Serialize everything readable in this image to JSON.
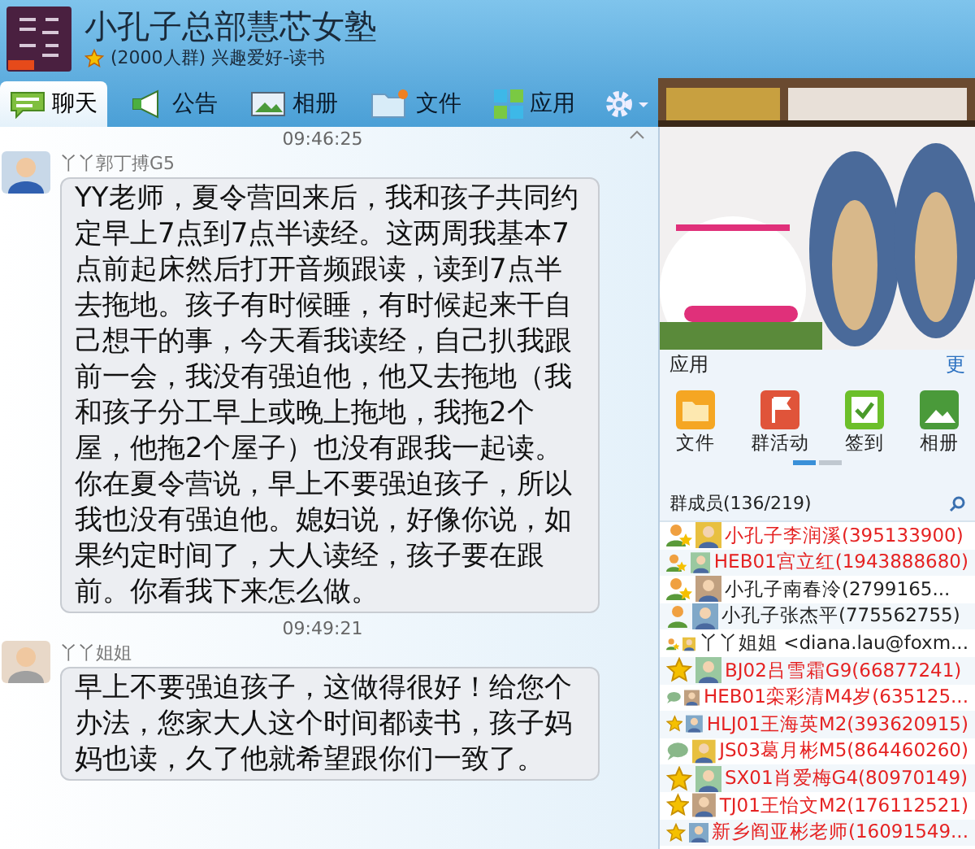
{
  "group": {
    "name": "小孔子总部慧芯女塾",
    "subtitle": "(2000人群) 兴趣爱好-读书"
  },
  "tabs": [
    {
      "label": "聊天",
      "kind": "chat",
      "selected": true
    },
    {
      "label": "公告",
      "kind": "notice",
      "selected": false
    },
    {
      "label": "相册",
      "kind": "album",
      "selected": false
    },
    {
      "label": "文件",
      "kind": "file",
      "selected": false
    },
    {
      "label": "应用",
      "kind": "apps",
      "selected": false
    }
  ],
  "messages": [
    {
      "time": "09:46:25",
      "sender": "丫丫郭丁搏G5",
      "paragraphs": [
        "YY老师，夏令营回来后，我和孩子共同约定早上7点到7点半读经。这两周我基本7点前起床然后打开音频跟读，读到7点半去拖地。孩子有时候睡，有时候起来干自己想干的事，今天看我读经，自己扒我跟前一会，我没有强迫他，他又去拖地（我和孩子分工早上或晚上拖地，我拖2个屋，他拖2个屋子）也没有跟我一起读。",
        "你在夏令营说，早上不要强迫孩子，所以我也没有强迫他。媳妇说，好像你说，如果约定时间了，大人读经，孩子要在跟前。你看我下来怎么做。"
      ]
    },
    {
      "time": "09:49:21",
      "sender": "丫丫姐姐",
      "paragraphs": [
        "早上不要强迫孩子，这做得很好！给您个办法，您家大人这个时间都读书，孩子妈妈也读，久了他就希望跟你们一致了。"
      ]
    }
  ],
  "apps": {
    "title": "应用",
    "more": "更",
    "items": [
      {
        "label": "文件",
        "kind": "file"
      },
      {
        "label": "群活动",
        "kind": "event"
      },
      {
        "label": "签到",
        "kind": "checkin"
      },
      {
        "label": "相册",
        "kind": "album"
      }
    ]
  },
  "members": {
    "title": "群成员(136/219)",
    "items": [
      {
        "name": "小孔子李润溪(395133900)",
        "kind": "owner",
        "color": "#e52222"
      },
      {
        "name": "HEB01宫立红(1943888680)",
        "kind": "owner",
        "color": "#e52222"
      },
      {
        "name": "小孔子南春泠(2799165...",
        "kind": "owner",
        "color": "#222222"
      },
      {
        "name": "小孔子张杰平(775562755)",
        "kind": "admin",
        "color": "#222222"
      },
      {
        "name": "丫丫姐姐 <diana.lau@foxm...",
        "kind": "owner",
        "color": "#222222"
      },
      {
        "name": "BJ02吕雪霜G9(66877241)",
        "kind": "star",
        "color": "#e52222"
      },
      {
        "name": "HEB01栾彩清M4岁(635125...",
        "kind": "chat",
        "color": "#e52222"
      },
      {
        "name": "HLJ01王海英M2(393620915)",
        "kind": "star",
        "color": "#e52222"
      },
      {
        "name": "JS03葛月彬M5(864460260)",
        "kind": "chat",
        "color": "#e52222"
      },
      {
        "name": "SX01肖爱梅G4(80970149)",
        "kind": "star",
        "color": "#e52222"
      },
      {
        "name": "TJ01王怡文M2(176112521)",
        "kind": "star",
        "color": "#e52222"
      },
      {
        "name": "新乡阎亚彬老师(16091549...",
        "kind": "star",
        "color": "#e52222"
      }
    ]
  }
}
